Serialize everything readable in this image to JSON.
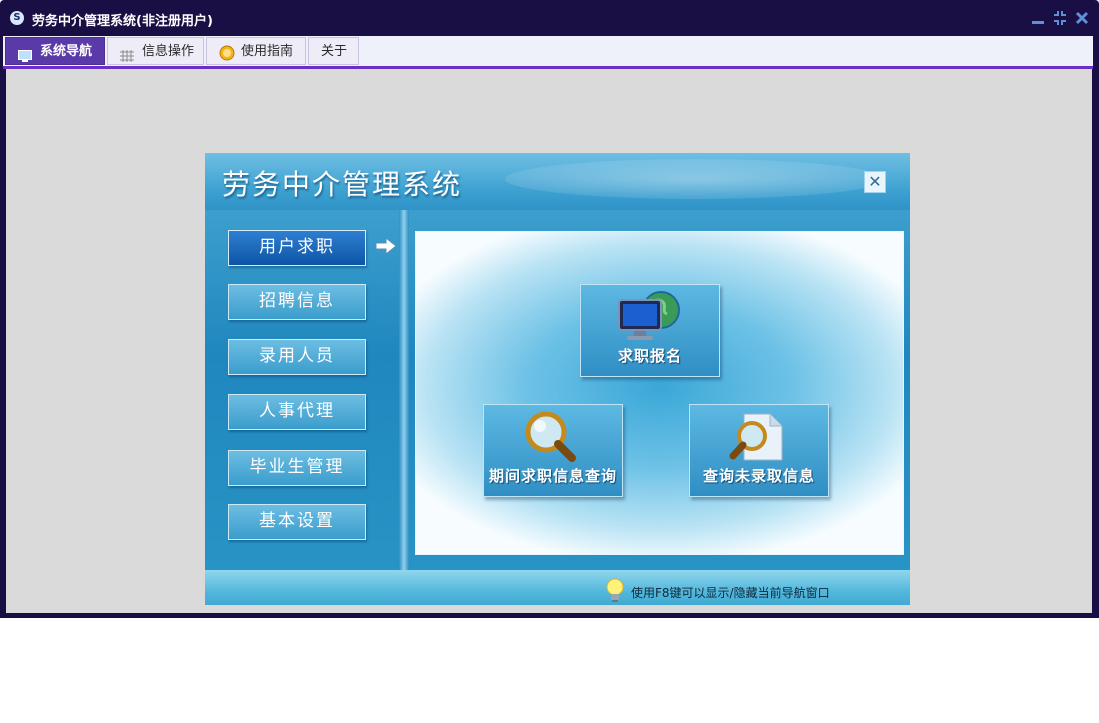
{
  "window": {
    "app_icon": "app-logo-icon",
    "title": "劳务中介管理系统(非注册用户)",
    "controls": [
      "minimize-icon",
      "restore-icon",
      "close-icon"
    ]
  },
  "menu": {
    "tabs": [
      {
        "label": "系统导航",
        "icon": "monitor-icon",
        "active": true
      },
      {
        "label": "信息操作",
        "icon": "grid-icon",
        "active": false
      },
      {
        "label": "使用指南",
        "icon": "help-coin-icon",
        "active": false
      },
      {
        "label": "关于",
        "icon": "",
        "active": false
      }
    ],
    "accent_color": "#6a2fc9"
  },
  "nav": {
    "title": "劳务中介管理系统",
    "close_glyph": "✕",
    "side_buttons": [
      {
        "label": "用户求职",
        "active": true
      },
      {
        "label": "招聘信息",
        "active": false
      },
      {
        "label": "录用人员",
        "active": false
      },
      {
        "label": "人事代理",
        "active": false
      },
      {
        "label": "毕业生管理",
        "active": false
      },
      {
        "label": "基本设置",
        "active": false
      }
    ],
    "functions": [
      {
        "label": "求职报名",
        "icon": "monitor-globe-icon"
      },
      {
        "label": "期间求职信息查询",
        "icon": "magnifier-icon"
      },
      {
        "label": "查询未录取信息",
        "icon": "document-search-icon"
      }
    ],
    "footer_hint": "使用F8键可以显示/隐藏当前导航窗口"
  }
}
